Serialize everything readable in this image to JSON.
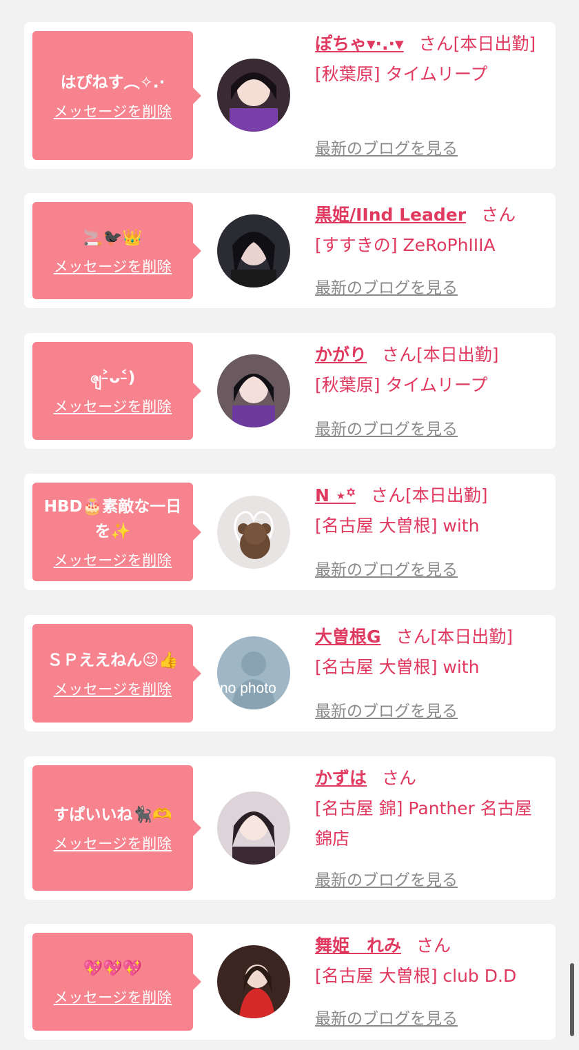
{
  "items": [
    {
      "message": "はぴねす︵✧.·",
      "delete_label": "メッセージを削除",
      "name": "ぽちゃ▾·.·▾",
      "san": "さん[本日出勤]",
      "shop": "[秋葉原] タイムリープ",
      "blog_label": "最新のブログを見る"
    },
    {
      "message": "🚬🐦‍⬛👑",
      "delete_label": "メッセージを削除",
      "name": "黒姫/IInd Leader",
      "san": "さん",
      "shop": "[すすきの] ZeRoPhIIIA",
      "blog_label": "最新のブログを見る"
    },
    {
      "message": "ၛ˃̵ᴗ˂̵)",
      "delete_label": "メッセージを削除",
      "name": "かがり",
      "san": "さん[本日出勤]",
      "shop": "[秋葉原] タイムリープ",
      "blog_label": "最新のブログを見る"
    },
    {
      "message": "HBD🎂素敵な一日を✨",
      "delete_label": "メッセージを削除",
      "name": "N ⋆꙳",
      "san": "さん[本日出勤]",
      "shop": "[名古屋 大曽根] with",
      "blog_label": "最新のブログを見る"
    },
    {
      "message": "ＳＰええねん😉👍",
      "delete_label": "メッセージを削除",
      "name": "大曽根G",
      "san": "さん[本日出勤]",
      "shop": "[名古屋 大曽根] with",
      "blog_label": "最新のブログを見る"
    },
    {
      "message": "すぱいいね🐈‍⬛🫶",
      "delete_label": "メッセージを削除",
      "name": "かずは",
      "san": "さん",
      "shop": "[名古屋 錦] Panther 名古屋錦店",
      "blog_label": "最新のブログを見る"
    },
    {
      "message": "💖💖💖",
      "delete_label": "メッセージを削除",
      "name": "舞姫　れみ",
      "san": "さん",
      "shop": "[名古屋 大曽根] club D.D",
      "blog_label": "最新のブログを見る"
    }
  ],
  "placeholder_avatar_text": "no photo",
  "colors": {
    "bubble": "#f7838f",
    "accent": "#e0395f",
    "link_gray": "#8a8a8a",
    "background": "#f2f2f2"
  }
}
